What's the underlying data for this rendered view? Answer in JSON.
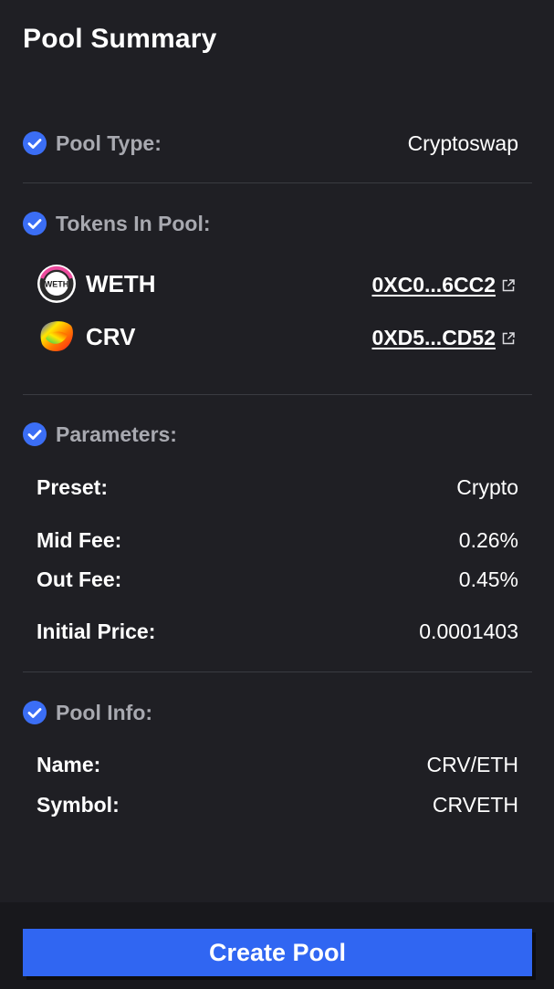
{
  "title": "Pool Summary",
  "pool_type": {
    "label": "Pool Type:",
    "value": "Cryptoswap"
  },
  "tokens": {
    "label": "Tokens In Pool:",
    "items": [
      {
        "symbol": "WETH",
        "address": "0XC0...6CC2",
        "logo": "weth-logo"
      },
      {
        "symbol": "CRV",
        "address": "0XD5...CD52",
        "logo": "crv-logo"
      }
    ]
  },
  "parameters": {
    "label": "Parameters:",
    "preset": {
      "label": "Preset:",
      "value": "Crypto"
    },
    "mid_fee": {
      "label": "Mid Fee:",
      "value": "0.26%"
    },
    "out_fee": {
      "label": "Out Fee:",
      "value": "0.45%"
    },
    "initial_price": {
      "label": "Initial Price:",
      "value": "0.0001403"
    }
  },
  "pool_info": {
    "label": "Pool Info:",
    "name": {
      "label": "Name:",
      "value": "CRV/ETH"
    },
    "symbol": {
      "label": "Symbol:",
      "value": "CRVETH"
    }
  },
  "create_button": "Create Pool",
  "colors": {
    "background": "#1f1f24",
    "accent": "#3066f2",
    "check": "#3b6ef5",
    "muted_label": "#a8a9b0"
  }
}
